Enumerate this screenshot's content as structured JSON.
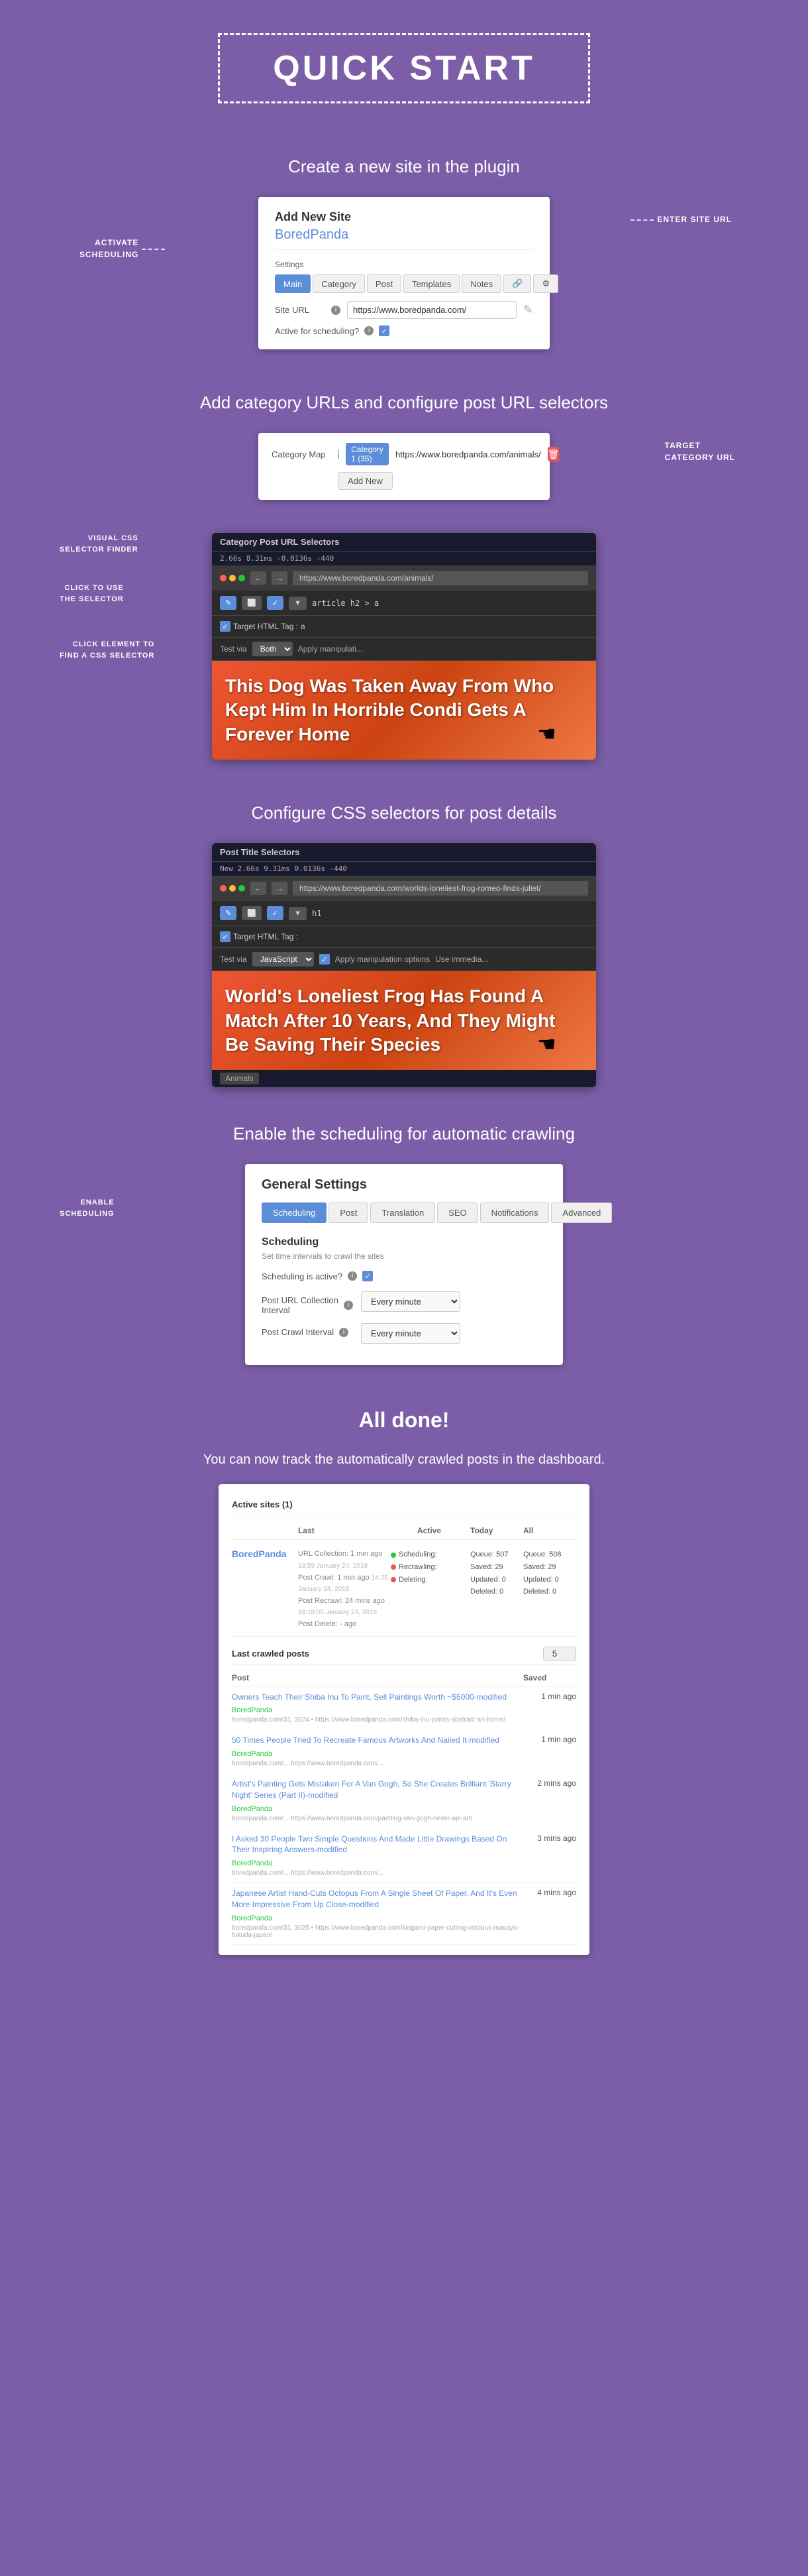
{
  "quickstart": {
    "title": "QUICK START",
    "subtitle1": "Create a new site in the plugin",
    "subtitle2": "Add category URLs and configure post URL selectors",
    "subtitle3": "Configure CSS selectors for post details",
    "subtitle4": "Enable the scheduling for automatic crawling",
    "subtitle5": "All done!",
    "subtitle5b": "You can now track the automatically crawled posts in the dashboard."
  },
  "addSite": {
    "title": "Add New Site",
    "siteName": "BoredPanda",
    "settingsLabel": "Settings",
    "tabs": [
      "Main",
      "Category",
      "Post",
      "Templates",
      "Notes"
    ],
    "siteUrlLabel": "Site URL",
    "siteUrlInfo": "i",
    "siteUrlValue": "https://www.boredpanda.com/",
    "activeLabel": "Active for scheduling?",
    "activeInfo": "i"
  },
  "annotations": {
    "activateScheduling": "ACTIVATE\nSCHEDULING",
    "enterSiteUrl": "ENTER SITE URL",
    "targetCategoryUrl": "TARGET\nCATEGORY URL",
    "visualCssFinder": "VISUAL CSS\nSELECTOR FINDER",
    "clickToUse": "CLICK TO USE\nTHE SELECTOR",
    "clickElement": "CLICK ELEMENT TO\nFIND A CSS SELECTOR",
    "enableScheduling": "ENABLE\nSCHEDULING"
  },
  "categoryMap": {
    "label": "Category Map",
    "info": "i",
    "badgeText": "Category 1 (35)",
    "url": "https://www.boredpanda.com/animals/",
    "addNewLabel": "Add New"
  },
  "browserMockup1": {
    "title": "Category Post URL Selectors",
    "urlBar": "https://www.boredpanda.com/animals/",
    "stats": "2.66s 8.31ms -0.0136s -440",
    "selectorPath": "article h2 > a",
    "targetHtmlTag": "Target HTML Tag :",
    "testViaLabel": "Test via",
    "testViaValue": "Both",
    "applyManipLabel": "Apply manipulati...",
    "contentText": "This Dog Was Taken Away From\nWho Kept Him In Horrible Condi\nGets A Forever Home",
    "toolBtns": [
      "←",
      "→",
      "pencil",
      "copy",
      "check",
      "dropdown"
    ]
  },
  "browserMockup2": {
    "title": "Post Title Selectors",
    "urlBar": "https://www.boredpanda.com/worlds-loneliest-frog-romeo-finds-juliet/",
    "stats": "New 2.66s 9.31ms 0.0136s -440",
    "selectorPath": "h1",
    "targetHtmlTag": "Target HTML Tag :",
    "testViaLabel": "Test via",
    "testViaValue": "JavaScript",
    "applyManipLabel": "Apply manipulation options",
    "useImmediateLabel": "Use immedia...",
    "contentText": "World's Loneliest Frog Has Found A\nMatch After 10 Years, And They Might\nBe Saving Their Species",
    "bottomTag": "Animals"
  },
  "generalSettings": {
    "title": "General Settings",
    "tabs": [
      "Scheduling",
      "Post",
      "Translation",
      "SEO",
      "Notifications",
      "Advanced"
    ],
    "activeTab": "Scheduling",
    "scheduling": {
      "heading": "Scheduling",
      "description": "Set time intervals to crawl the sites",
      "activeLabel": "Scheduling is active?",
      "postUrlLabel": "Post URL Collection\nInterval",
      "postUrlInfo": "i",
      "postUrlValue": "Every minute",
      "postCrawlLabel": "Post Crawl Interval",
      "postCrawlInfo": "i",
      "postCrawlValue": "Every minute"
    }
  },
  "dashboard": {
    "activeSitesLabel": "Active sites (1)",
    "tableHeaders": [
      "",
      "Last",
      "Active",
      "Today",
      "All"
    ],
    "site": {
      "name": "BoredPanda",
      "lastDetails": [
        "URL Collection: 1 min ago",
        "Post Crawl: 1 min ago",
        "Post Recrawl: 24 mins ago",
        "Post Delete: - ago"
      ],
      "lastTimestamps": [
        "13:59 January 24, 2018",
        "14:25 January 24, 2018",
        "19:18:00 January 24, 2018",
        ""
      ],
      "activeStatus": {
        "schedulingActive": true,
        "recrawlingActive": false,
        "deletingActive": false,
        "labels": [
          "Scheduling:",
          "Recrawling:",
          "Deleting:"
        ]
      },
      "todayCounts": {
        "queue": "Queue: 507",
        "saved": "Saved: 29",
        "updated": "Updated: 0",
        "deleted": "Deleted: 0"
      },
      "allCounts": {
        "queue": "Queue: 508",
        "saved": "Saved: 29",
        "updated": "Updated: 0",
        "deleted": "Deleted: 0"
      }
    },
    "crawledPostsLabel": "Last crawled posts",
    "crawledCount": "5",
    "crawledHeaders": [
      "Post",
      "Saved"
    ],
    "posts": [
      {
        "title": "Owners Teach Their Shiba Inu To Paint, Sell Paintings Worth ~$5000-modified",
        "site": "BoredPanda",
        "url": "boredpanda.com/31, 3024 • https://www.boredpanda.com/shiba-inu-paints-abstract-art-home/",
        "saved": "1 min ago"
      },
      {
        "title": "50 Times People Tried To Recreate Famous Artworks And Nailed It-modified",
        "site": "BoredPanda",
        "url": "boredpanda.com/... https://www.boredpanda.com/...",
        "saved": "1 min ago"
      },
      {
        "title": "Artist's Painting Gets Mistaken For A Van Gogh, So She Creates Brilliant 'Starry Night' Series (Part II)-modified",
        "site": "BoredPanda",
        "url": "boredpanda.com/... https://www.boredpanda.com/painting-van-gogh-never-api-art/",
        "saved": "2 mins ago"
      },
      {
        "title": "I Asked 30 People Two Simple Questions And Made Little Drawings Based On Their Inspiring Answers-modified",
        "site": "BoredPanda",
        "url": "boredpanda.com/... https://www.boredpanda.com/...",
        "saved": "3 mins ago"
      },
      {
        "title": "Japanese Artist Hand-Cuts Octopus From A Single Sheet Of Paper, And It's Even More Impressive From Up Close-modified",
        "site": "BoredPanda",
        "url": "boredpanda.com/31, 3025 • https://www.boredpanda.com/kirigami-paper-cutting-octopus-masayo-fukuda-japan/",
        "saved": "4 mins ago"
      }
    ]
  }
}
